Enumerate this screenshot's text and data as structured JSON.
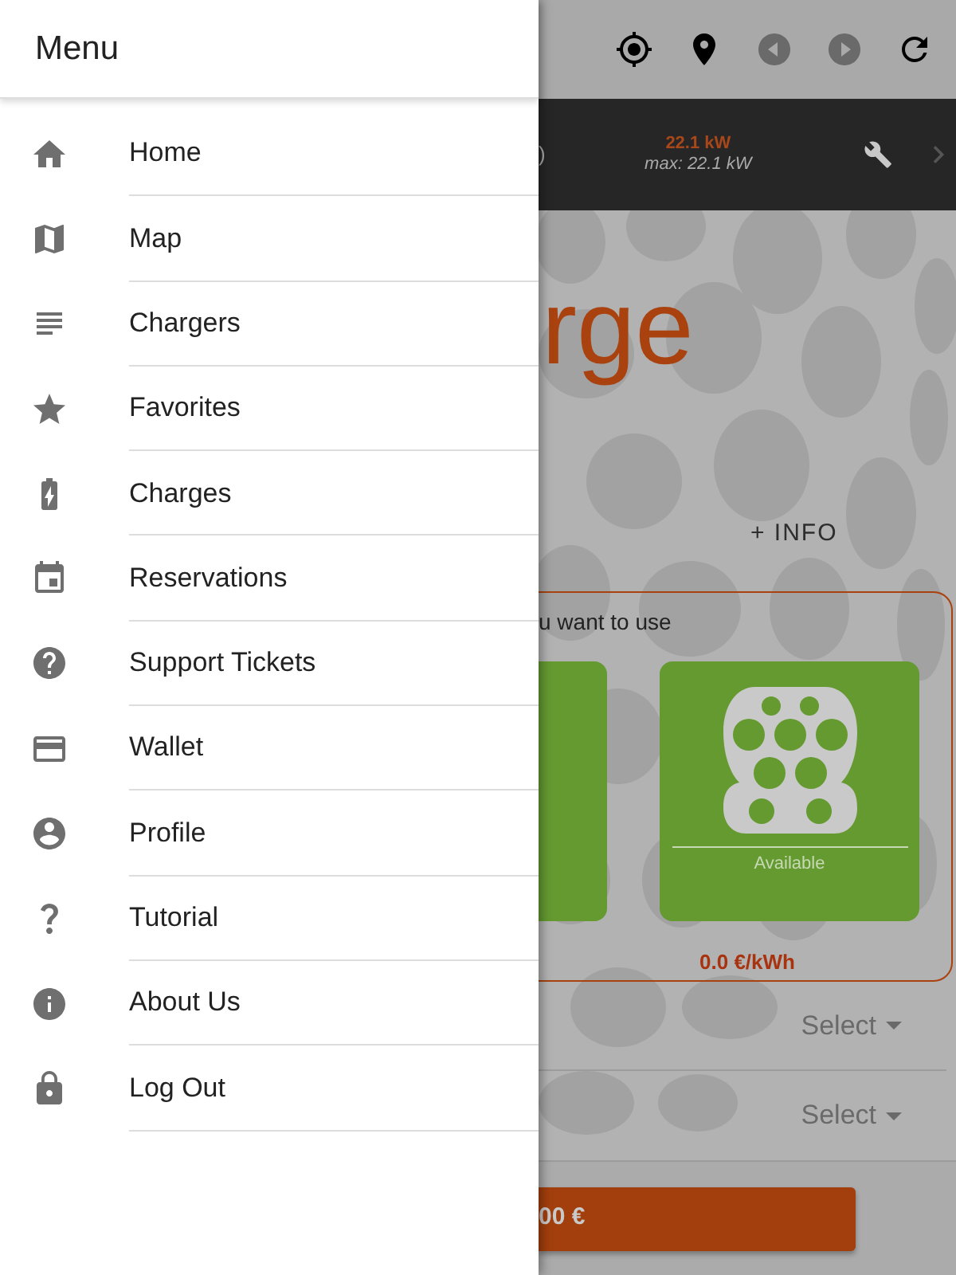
{
  "drawer": {
    "title": "Menu",
    "items": [
      {
        "label": "Home"
      },
      {
        "label": "Map"
      },
      {
        "label": "Chargers"
      },
      {
        "label": "Favorites"
      },
      {
        "label": "Charges"
      },
      {
        "label": "Reservations"
      },
      {
        "label": "Support Tickets"
      },
      {
        "label": "Wallet"
      },
      {
        "label": "Profile"
      },
      {
        "label": "Tutorial"
      },
      {
        "label": "About Us"
      },
      {
        "label": "Log Out"
      }
    ]
  },
  "charger_bar": {
    "name_fragment": ")",
    "power": "22.1 kW",
    "max_power": "max: 22.1 kW"
  },
  "page": {
    "title_fragment": "rge",
    "info_link": "+ INFO",
    "connector_card": {
      "prompt_fragment": "u want to use",
      "connectors": [
        {
          "kind": "partial"
        },
        {
          "kind": "full",
          "status": "Available",
          "price": "0.0 €/kWh"
        }
      ]
    },
    "selects": [
      {
        "value": "Select"
      },
      {
        "value": "Select"
      }
    ],
    "pay_button": "00 €"
  }
}
